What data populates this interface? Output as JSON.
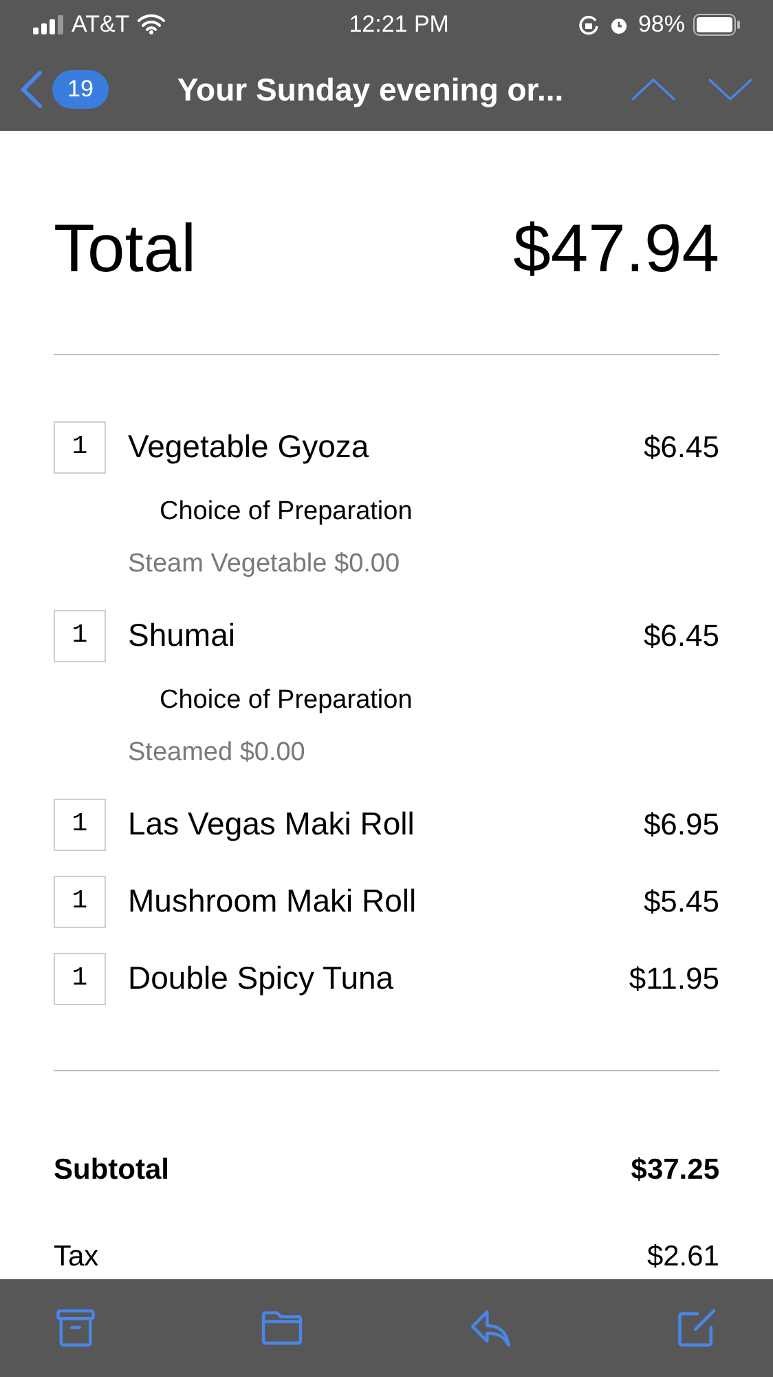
{
  "status_bar": {
    "carrier": "AT&T",
    "time": "12:21 PM",
    "battery": "98%"
  },
  "nav": {
    "unread_count": "19",
    "title": "Your Sunday evening or..."
  },
  "total": {
    "label": "Total",
    "amount": "$47.94"
  },
  "items": [
    {
      "quantity": "1",
      "name": "Vegetable Gyoza",
      "price": "$6.45",
      "options": [
        {
          "title": "Choice of Preparation",
          "value": "Steam Vegetable $0.00"
        }
      ]
    },
    {
      "quantity": "1",
      "name": "Shumai",
      "price": "$6.45",
      "options": [
        {
          "title": "Choice of Preparation",
          "value": "Steamed $0.00"
        }
      ]
    },
    {
      "quantity": "1",
      "name": "Las Vegas Maki Roll",
      "price": "$6.95"
    },
    {
      "quantity": "1",
      "name": "Mushroom Maki Roll",
      "price": "$5.45"
    },
    {
      "quantity": "1",
      "name": "Double Spicy Tuna",
      "price": "$11.95"
    }
  ],
  "summary": [
    {
      "kind": "bold",
      "label": "Subtotal",
      "amount": "$37.25"
    },
    {
      "kind": "plain",
      "label": "Tax",
      "amount": "$2.61"
    }
  ]
}
